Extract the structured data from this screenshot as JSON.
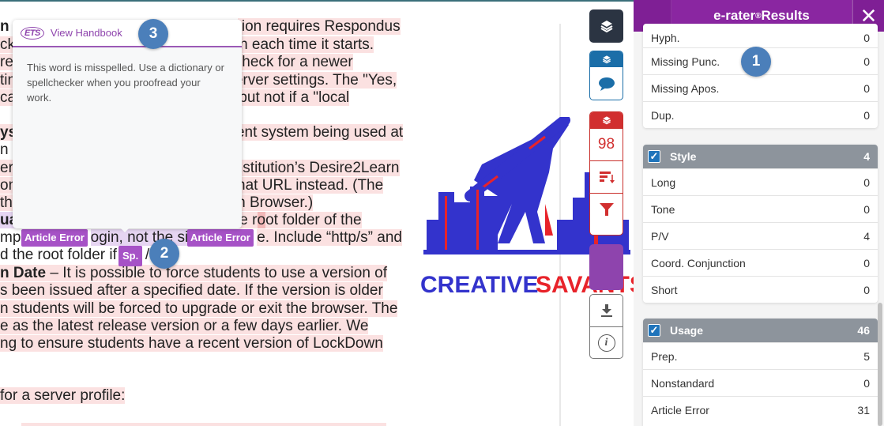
{
  "document": {
    "lines": [
      {
        "pre": "n",
        "text": " ",
        "post": "tion requires Respondus"
      },
      {
        "pre": "ck",
        "post": "tion each time it starts."
      },
      {
        "pre": "re",
        "post": "o check for a newer"
      },
      {
        "pre": "tin",
        "post": " server settings. The \"Yes,"
      },
      {
        "pre": "cal",
        "post": "k, but not if a \"local"
      },
      {
        "pre": "ys",
        "post": "ment system being used at"
      },
      {
        "pre": "n",
        "post": ""
      },
      {
        "pre": "er",
        "post": "r institution’s Desire2Learn"
      },
      {
        "pre": "on",
        "post": "r that URL instead. (The"
      },
      {
        "pre": "th",
        "post": "own Browser.)"
      },
      {
        "pre": "ua",
        "post_a": " the r",
        "post_hl": "o",
        "post_b": "ot folder of the"
      },
      {
        "pre": "mpl",
        "mid": "ogin, not the si",
        "post": "e.  Include “http/s” and"
      },
      {
        "pre": "d the root folder if",
        "post": "/"
      },
      {
        "bold": "n Date",
        "post": " – It is possible to force students to use a version of"
      },
      {
        "post": "s been issued after a specified date. If the version is older"
      },
      {
        "post": "n students will be forced to upgrade or exit the browser. The"
      },
      {
        "post": "e as the latest release version or a few days earlier. We"
      },
      {
        "post": "ng to ensure students have a recent version of LockDown"
      },
      {
        "post": "for a server profile:"
      }
    ]
  },
  "tooltip": {
    "logo": "ETS",
    "link": "View Handbook",
    "message": "This word is misspelled. Use a dictionary or spellchecker when you proofread your work."
  },
  "badges": {
    "article_error_1": "Article Error",
    "article_error_2": "Article Error",
    "spelling": "Sp."
  },
  "steps": {
    "one": "1",
    "two": "2",
    "three": "3"
  },
  "watermark": {
    "word1": "CREATIVE",
    "word2": "SAVANTS"
  },
  "toolbar": {
    "layers_icon": "layers-icon",
    "comment_icon": "speech-bubble-icon",
    "score": "98",
    "sort_icon": "sort-icon",
    "filter_icon": "filter-icon",
    "download_icon": "download-icon",
    "info_icon": "info-icon",
    "info_glyph": "i"
  },
  "panel": {
    "title": "e-rater",
    "title_sup": "®",
    "title_suffix": " Results",
    "close": "✕",
    "mechanics_rows": [
      {
        "label": "Hyph.",
        "count": "0"
      },
      {
        "label": "Missing Punc.",
        "count": "0"
      },
      {
        "label": "Missing Apos.",
        "count": "0"
      },
      {
        "label": "Dup.",
        "count": "0"
      }
    ],
    "style": {
      "label": "Style",
      "count": "4",
      "checked": true,
      "rows": [
        {
          "label": "Long",
          "count": "0"
        },
        {
          "label": "Tone",
          "count": "0"
        },
        {
          "label": "P/V",
          "count": "4"
        },
        {
          "label": "Coord. Conjunction",
          "count": "0"
        },
        {
          "label": "Short",
          "count": "0"
        }
      ]
    },
    "usage": {
      "label": "Usage",
      "count": "46",
      "checked": true,
      "rows": [
        {
          "label": "Prep.",
          "count": "5"
        },
        {
          "label": "Nonstandard",
          "count": "0"
        },
        {
          "label": "Article Error",
          "count": "31"
        }
      ]
    }
  },
  "colors": {
    "panel_header": "#7f1f95",
    "badge": "#a652c6",
    "error_highlight": "#fbe1e1",
    "score_red": "#d12f2f",
    "step_blue": "#4b7fba"
  }
}
